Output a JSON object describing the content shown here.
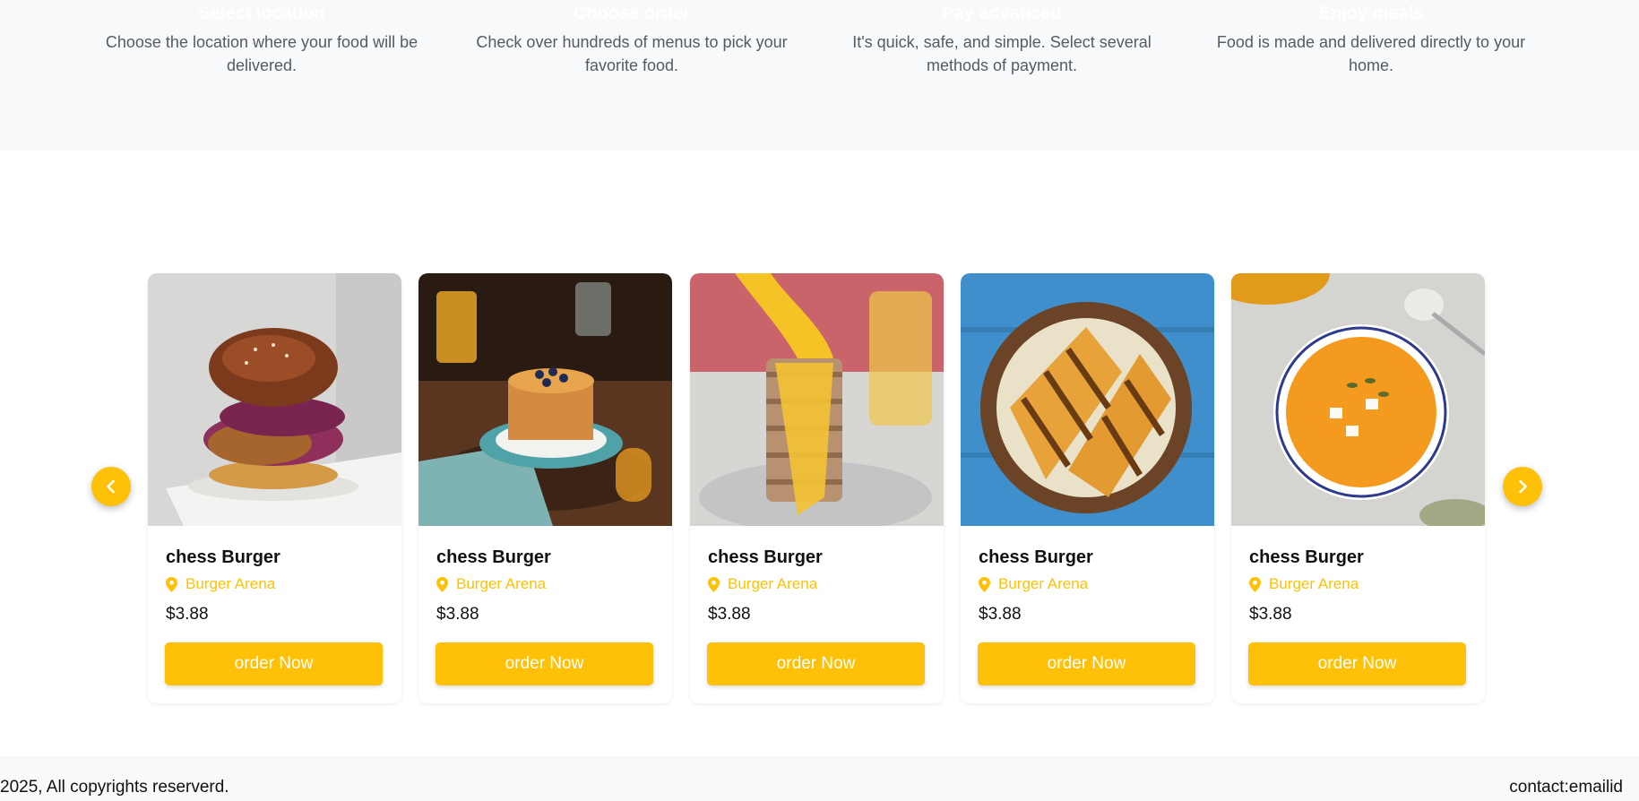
{
  "steps": [
    {
      "title": "Select location",
      "text_line1": "Choose the location where your food will be",
      "text_line2": "delivered."
    },
    {
      "title": "Choose order",
      "text_line1": "Check over hundreds of menus to pick your",
      "text_line2": "favorite food."
    },
    {
      "title": "Pay advanced",
      "text_line1": "It's quick, safe, and simple. Select several",
      "text_line2": "methods of payment."
    },
    {
      "title": "Enjoy meals",
      "text_line1": "Food is made and delivered directly to your",
      "text_line2": "home."
    }
  ],
  "carousel": {
    "prev_icon": "chevron-left-icon",
    "next_icon": "chevron-right-icon",
    "accent_color": "#ffc107",
    "cards": [
      {
        "image": "burger-photo",
        "name": "chess Burger",
        "restaurant": "Burger Arena",
        "price": "$3.88",
        "button": "order Now"
      },
      {
        "image": "pancakes-blueberry-photo",
        "name": "chess Burger",
        "restaurant": "Burger Arena",
        "price": "$3.88",
        "button": "order Now"
      },
      {
        "image": "pancakes-syrup-photo",
        "name": "chess Burger",
        "restaurant": "Burger Arena",
        "price": "$3.88",
        "button": "order Now"
      },
      {
        "image": "toast-sandwich-photo",
        "name": "chess Burger",
        "restaurant": "Burger Arena",
        "price": "$3.88",
        "button": "order Now"
      },
      {
        "image": "pumpkin-soup-photo",
        "name": "chess Burger",
        "restaurant": "Burger Arena",
        "price": "$3.88",
        "button": "order Now"
      }
    ]
  },
  "footer": {
    "copyright": "2025, All copyrights reserverd.",
    "contact": "contact:emailid"
  }
}
